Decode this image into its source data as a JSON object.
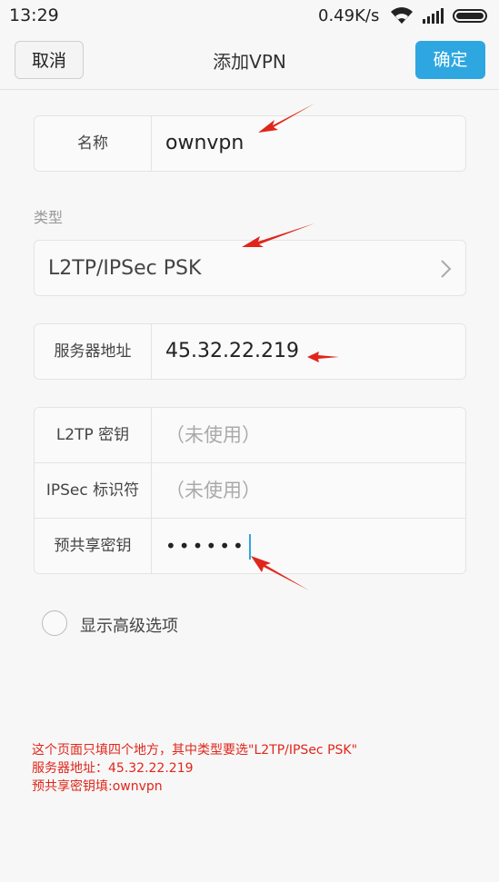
{
  "statusbar": {
    "time": "13:29",
    "speed": "0.49K/s",
    "wifi_icon": "wifi-icon",
    "signal_icon": "signal-icon",
    "battery_icon": "battery-icon"
  },
  "header": {
    "cancel_label": "取消",
    "title": "添加VPN",
    "ok_label": "确定",
    "ok_color": "#2ea7e0"
  },
  "form": {
    "name_label": "名称",
    "name_value": "ownvpn",
    "type_section_label": "类型",
    "type_value": "L2TP/IPSec PSK",
    "server_label": "服务器地址",
    "server_value": "45.32.22.219",
    "l2tp_label": "L2TP 密钥",
    "l2tp_placeholder": "（未使用）",
    "ipsec_label": "IPSec 标识符",
    "ipsec_placeholder": "（未使用）",
    "psk_label": "预共享密钥",
    "psk_value": "••••••",
    "advanced_label": "显示高级选项"
  },
  "annotation": {
    "color": "#e0261b",
    "lines": [
      "这个页面只填四个地方，其中类型要选\"L2TP/IPSec PSK\"",
      "服务器地址：45.32.22.219",
      "预共享密钥填:ownvpn"
    ]
  }
}
